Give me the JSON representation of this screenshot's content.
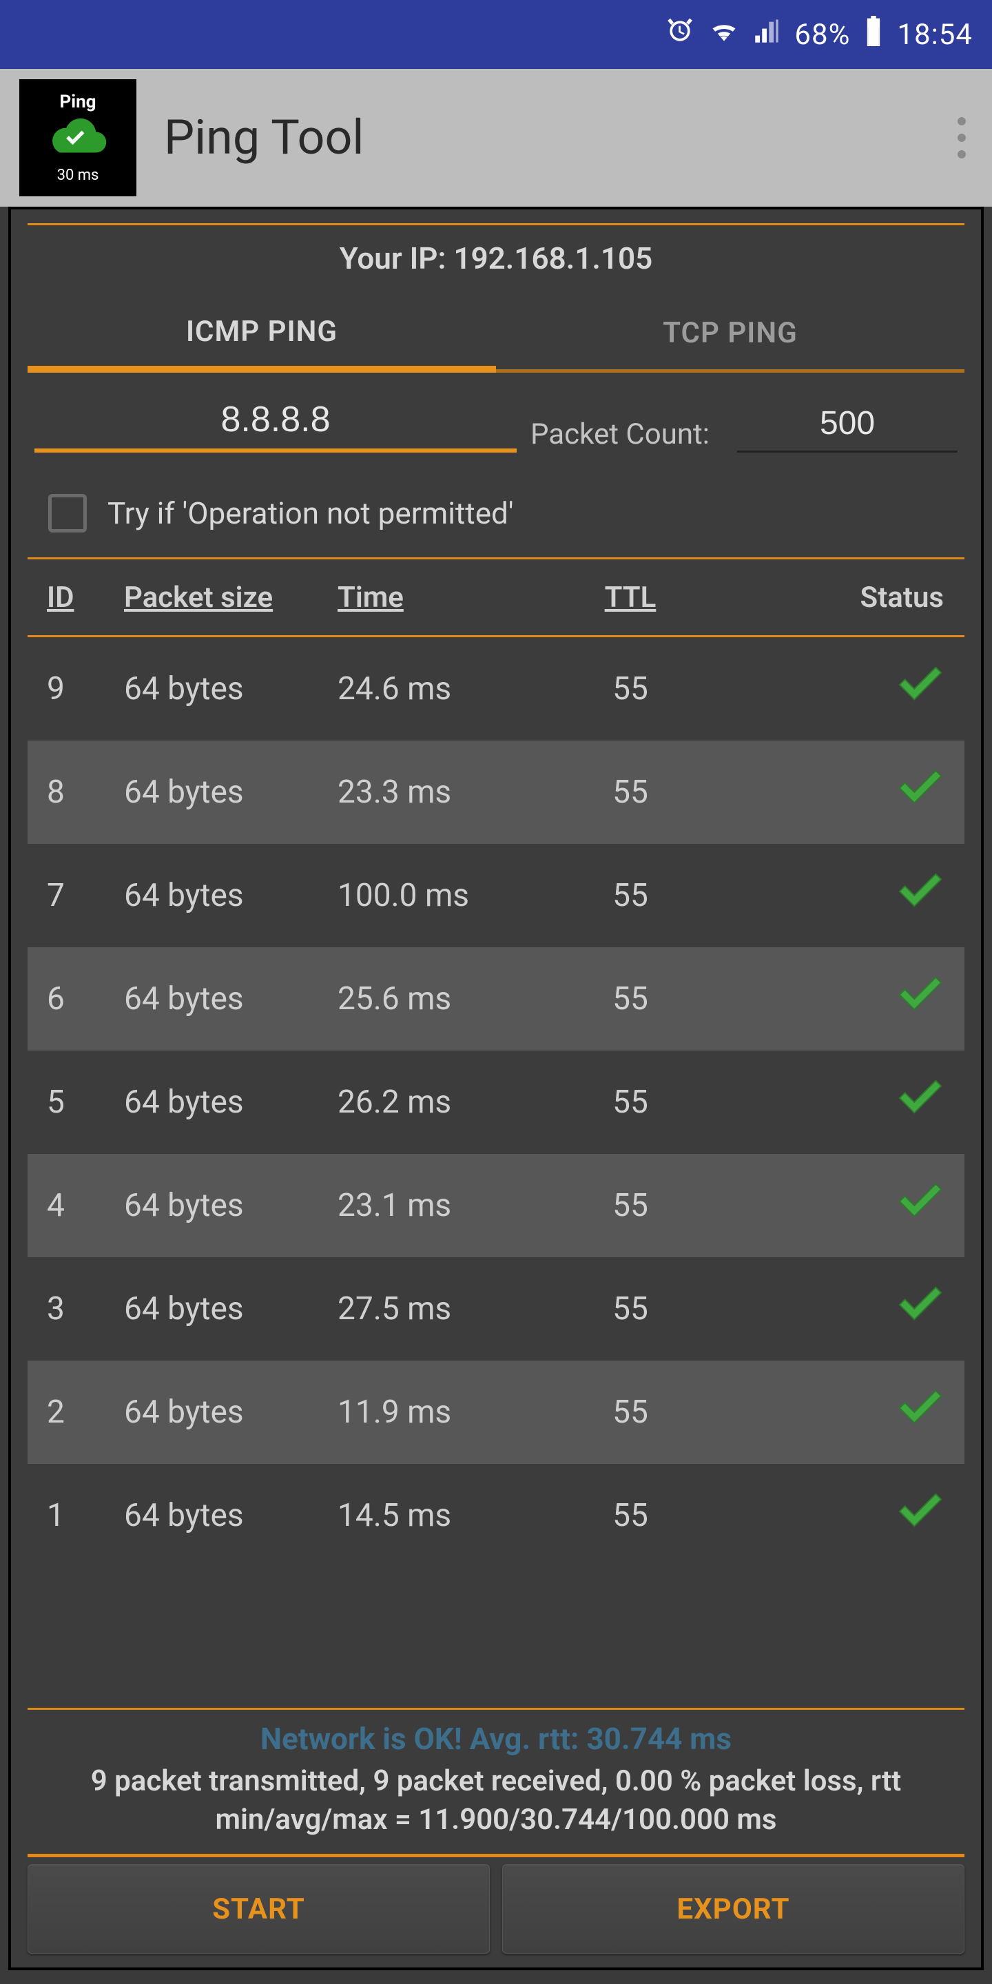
{
  "statusbar": {
    "battery_pct": "68%",
    "clock": "18:54"
  },
  "appbar": {
    "icon_top": "Ping",
    "icon_bottom": "30 ms",
    "title": "Ping Tool"
  },
  "panel": {
    "your_ip_label": "Your IP: 192.168.1.105",
    "tabs": {
      "icmp": "ICMP PING",
      "tcp": "TCP PING"
    },
    "ip_value": "8.8.8.8",
    "packet_count_label": "Packet Count:",
    "packet_count_value": "500",
    "checkbox_label": "Try if 'Operation not permitted'",
    "headers": {
      "id": "ID",
      "size": "Packet size",
      "time": "Time",
      "ttl": "TTL",
      "status": "Status"
    },
    "rows": [
      {
        "id": "9",
        "size": "64 bytes",
        "time": "24.6 ms",
        "ttl": "55",
        "ok": true
      },
      {
        "id": "8",
        "size": "64 bytes",
        "time": "23.3 ms",
        "ttl": "55",
        "ok": true
      },
      {
        "id": "7",
        "size": "64 bytes",
        "time": "100.0 ms",
        "ttl": "55",
        "ok": true
      },
      {
        "id": "6",
        "size": "64 bytes",
        "time": "25.6 ms",
        "ttl": "55",
        "ok": true
      },
      {
        "id": "5",
        "size": "64 bytes",
        "time": "26.2 ms",
        "ttl": "55",
        "ok": true
      },
      {
        "id": "4",
        "size": "64 bytes",
        "time": "23.1 ms",
        "ttl": "55",
        "ok": true
      },
      {
        "id": "3",
        "size": "64 bytes",
        "time": "27.5 ms",
        "ttl": "55",
        "ok": true
      },
      {
        "id": "2",
        "size": "64 bytes",
        "time": "11.9 ms",
        "ttl": "55",
        "ok": true
      },
      {
        "id": "1",
        "size": "64 bytes",
        "time": "14.5 ms",
        "ttl": "55",
        "ok": true
      }
    ],
    "summary": {
      "ok_line": "Network is OK! Avg. rtt: 30.744 ms",
      "stats_line": "9 packet transmitted, 9 packet received, 0.00 % packet loss, rtt min/avg/max = 11.900/30.744/100.000 ms"
    },
    "buttons": {
      "start": "START",
      "export": "EXPORT"
    }
  }
}
